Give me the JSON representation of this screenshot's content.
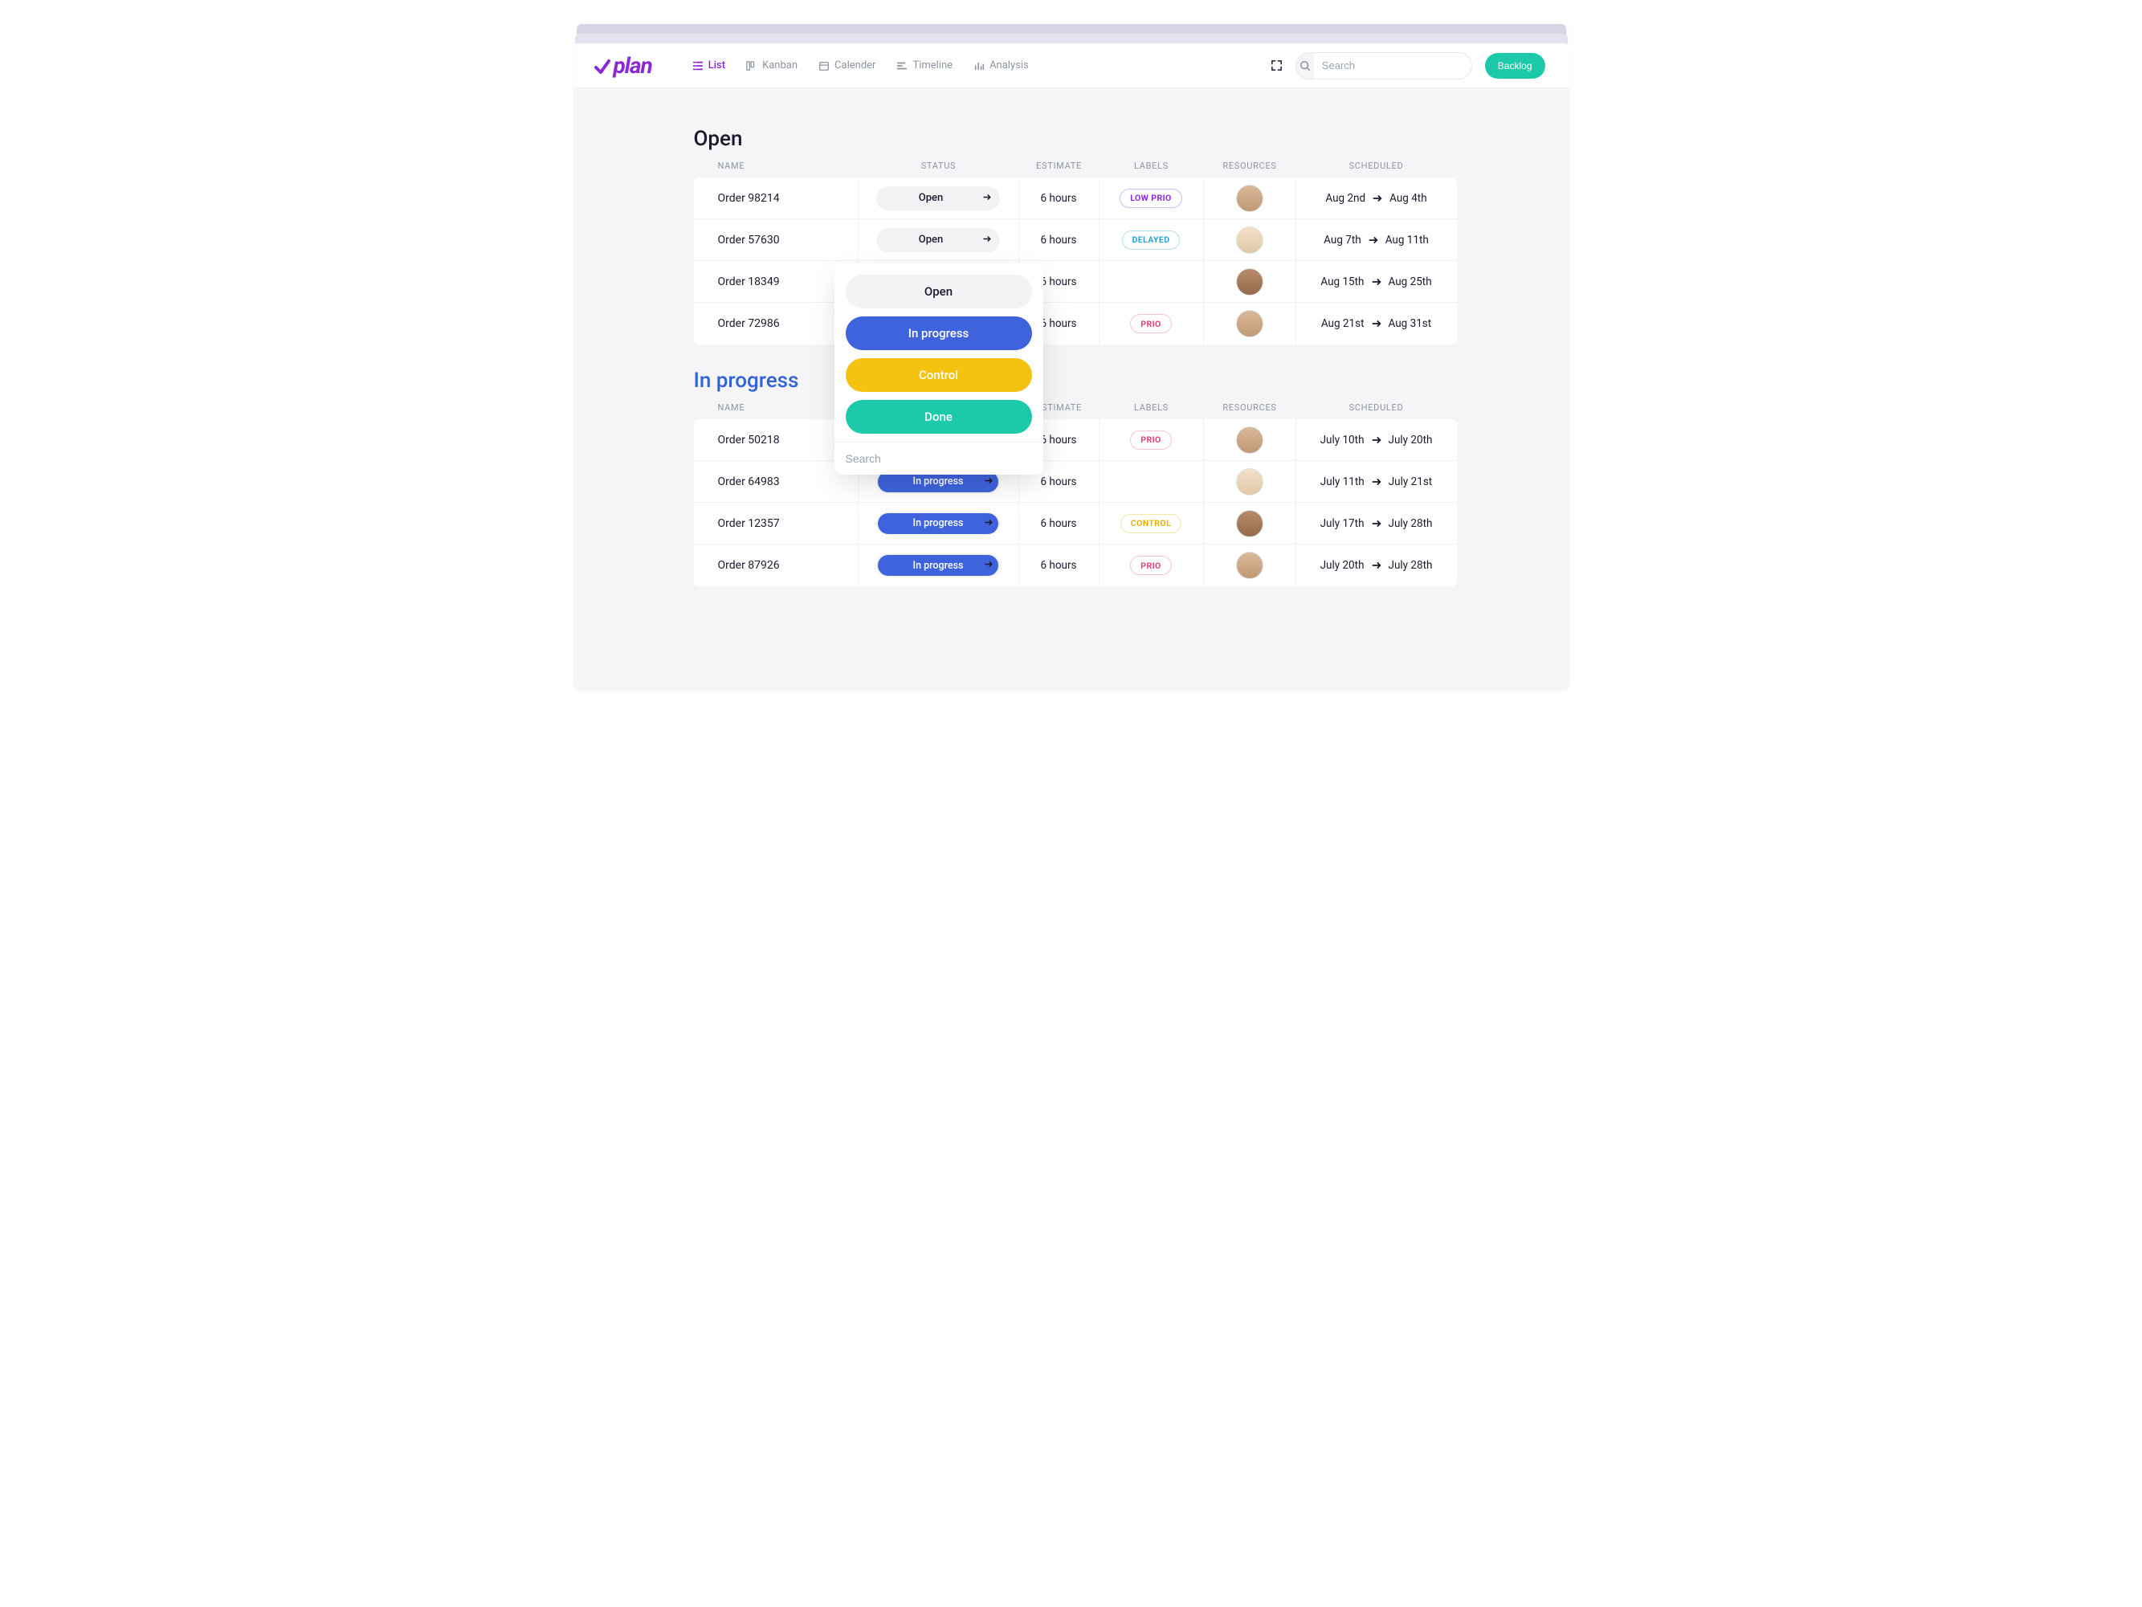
{
  "brand": "plan",
  "tabs": {
    "list": "List",
    "kanban": "Kanban",
    "calender": "Calender",
    "timeline": "Timeline",
    "analysis": "Analysis"
  },
  "search": {
    "placeholder": "Search"
  },
  "backlog_button": "Backlog",
  "columns": {
    "name": "NAME",
    "status": "STATUS",
    "estimate": "ESTIMATE",
    "labels": "LABELS",
    "resources": "RESOURCES",
    "scheduled": "SCHEDULED"
  },
  "sections": {
    "open": {
      "title": "Open",
      "rows": [
        {
          "name": "Order 98214",
          "status": "Open",
          "estimate": "6 hours",
          "label": "LOW PRIO",
          "label_class": "lowprio",
          "start": "Aug 2nd",
          "end": "Aug 4th",
          "avatar": "a"
        },
        {
          "name": "Order 57630",
          "status": "Open",
          "estimate": "6 hours",
          "label": "DELAYED",
          "label_class": "delayed",
          "start": "Aug 7th",
          "end": "Aug 11th",
          "avatar": "b"
        },
        {
          "name": "Order 18349",
          "status": "Open",
          "estimate": "6 hours",
          "label": "",
          "label_class": "",
          "start": "Aug 15th",
          "end": "Aug 25th",
          "avatar": "c"
        },
        {
          "name": "Order 72986",
          "status": "Open",
          "estimate": "6 hours",
          "label": "PRIO",
          "label_class": "prio",
          "start": "Aug 21st",
          "end": "Aug 31st",
          "avatar": "a"
        }
      ]
    },
    "inprogress": {
      "title": "In progress",
      "rows": [
        {
          "name": "Order 50218",
          "status": "In progress",
          "estimate": "6 hours",
          "label": "PRIO",
          "label_class": "prio",
          "start": "July 10th",
          "end": "July 20th",
          "avatar": "a"
        },
        {
          "name": "Order 64983",
          "status": "In progress",
          "estimate": "6 hours",
          "label": "",
          "label_class": "",
          "start": "July 11th",
          "end": "July 21st",
          "avatar": "b"
        },
        {
          "name": "Order 12357",
          "status": "In progress",
          "estimate": "6 hours",
          "label": "CONTROL",
          "label_class": "control",
          "start": "July 17th",
          "end": "July 28th",
          "avatar": "c"
        },
        {
          "name": "Order 87926",
          "status": "In progress",
          "estimate": "6 hours",
          "label": "PRIO",
          "label_class": "prio",
          "start": "July 20th",
          "end": "July 28th",
          "avatar": "a"
        }
      ]
    }
  },
  "popover": {
    "open": "Open",
    "inprogress": "In progress",
    "control": "Control",
    "done": "Done",
    "search_placeholder": "Search"
  }
}
